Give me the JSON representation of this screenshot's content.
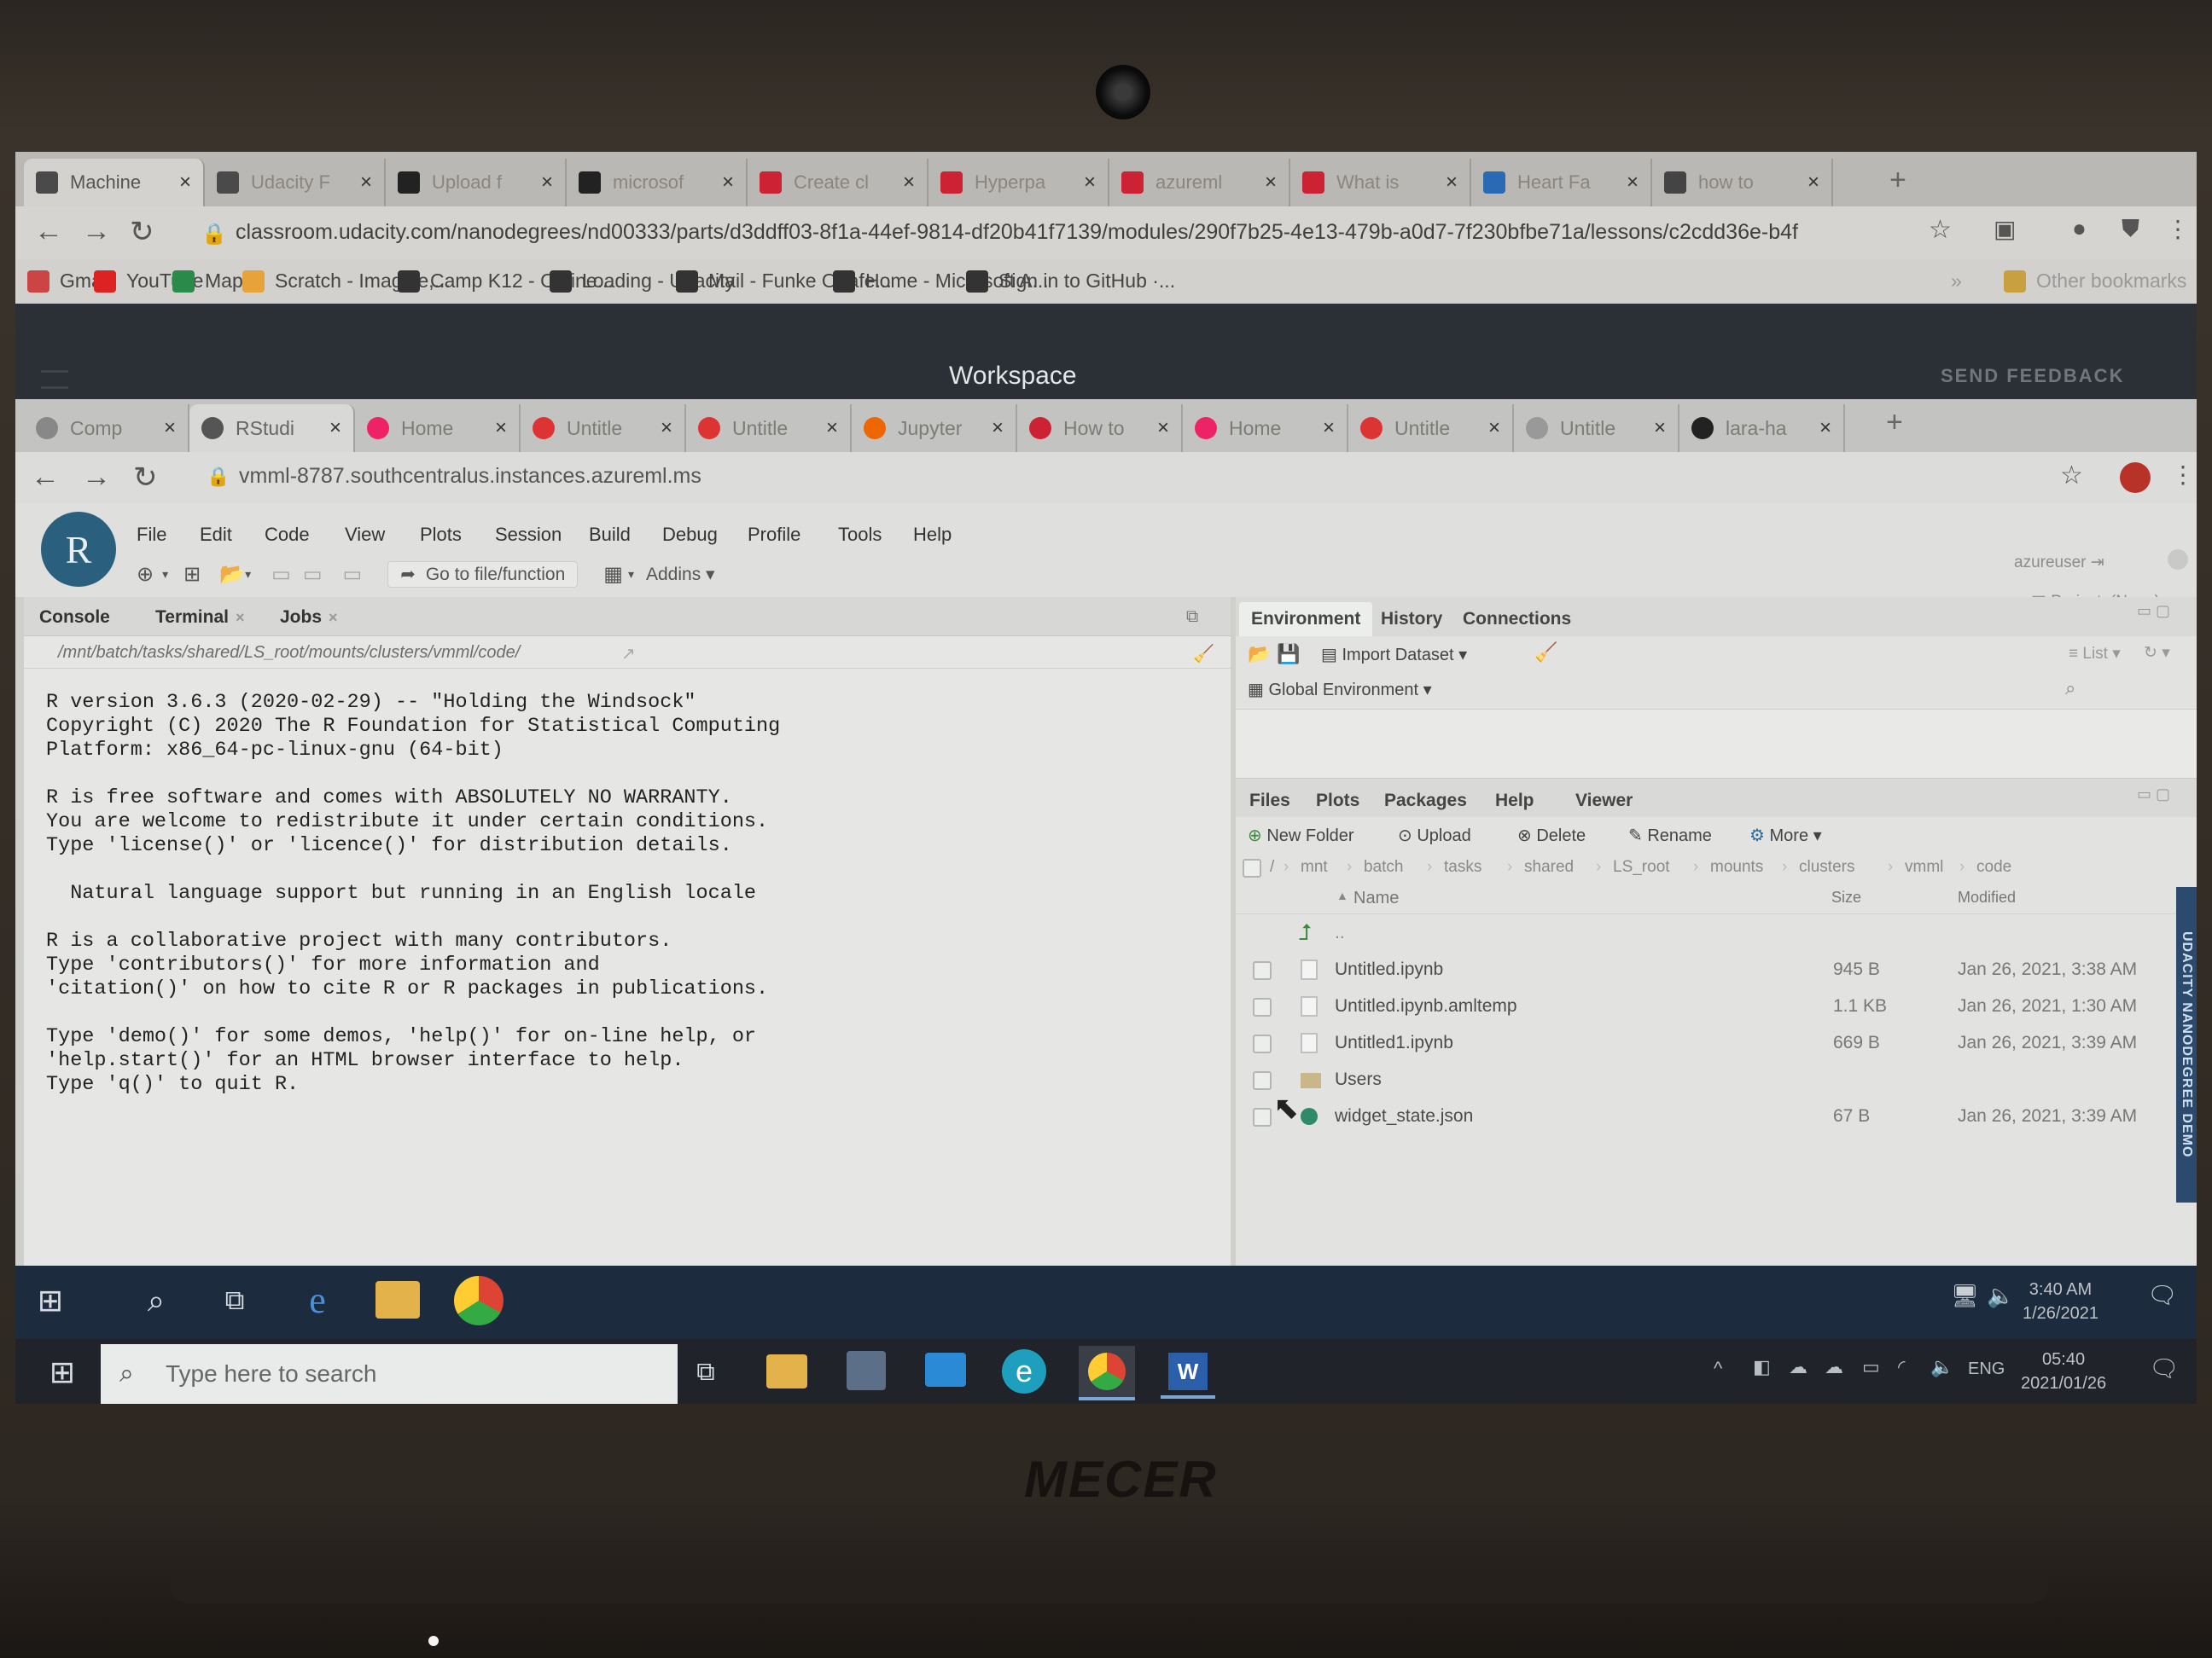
{
  "outer_browser": {
    "tabs": [
      {
        "title": "Machine",
        "favicon": "udacity-icon",
        "color": "#4a4a4a",
        "active": true
      },
      {
        "title": "Udacity F",
        "favicon": "udacity-icon",
        "color": "#4a4a4a"
      },
      {
        "title": "Upload f",
        "favicon": "github-icon",
        "color": "#222"
      },
      {
        "title": "microsof",
        "favicon": "github-icon",
        "color": "#222"
      },
      {
        "title": "Create cl",
        "favicon": "azure-ml-icon",
        "color": "#c23"
      },
      {
        "title": "Hyperpa",
        "favicon": "azure-ml-icon",
        "color": "#c23"
      },
      {
        "title": "azureml",
        "favicon": "azure-ml-icon",
        "color": "#c23"
      },
      {
        "title": "What is",
        "favicon": "azure-ml-icon",
        "color": "#c23"
      },
      {
        "title": "Heart Fa",
        "favicon": "kaggle-icon",
        "color": "#2a6ab5"
      },
      {
        "title": "how to",
        "favicon": "google-icon",
        "color": "#444"
      }
    ],
    "url": "classroom.udacity.com/nanodegrees/nd00333/parts/d3ddff03-8f1a-44ef-9814-df20b41f7139/modules/290f7b25-4e13-479b-a0d7-7f230bfbe71a/lessons/c2cdd36e-b4f",
    "bookmarks": [
      {
        "label": "Gmail",
        "icon": "gmail-icon",
        "color": "#c44"
      },
      {
        "label": "YouTube",
        "icon": "youtube-icon",
        "color": "#d22"
      },
      {
        "label": "Maps",
        "icon": "maps-icon",
        "color": "#2a8a4a"
      },
      {
        "label": "Scratch - Imagine,...",
        "icon": "scratch-icon",
        "color": "#e6a33a"
      },
      {
        "label": "Camp K12 - Online...",
        "icon": "campk12-icon",
        "color": "#333"
      },
      {
        "label": "Loading - Udacity",
        "icon": "udacity-icon",
        "color": "#333"
      },
      {
        "label": "Mail - Funke Onafe...",
        "icon": "outlook-icon",
        "color": "#333"
      },
      {
        "label": "Home - Microsoft A...",
        "icon": "azure-icon",
        "color": "#333"
      },
      {
        "label": "Sign in to GitHub ·...",
        "icon": "github-icon",
        "color": "#333"
      }
    ],
    "other_bookmarks": "Other bookmarks"
  },
  "workspace": {
    "title": "Workspace",
    "feedback": "SEND FEEDBACK"
  },
  "inner_browser": {
    "tabs": [
      {
        "title": "Comp",
        "favicon": "comp-icon",
        "color": "#888"
      },
      {
        "title": "RStudi",
        "favicon": "rstudio-icon",
        "color": "#555",
        "active": true
      },
      {
        "title": "Home",
        "favicon": "jupyter-icon",
        "color": "#e26"
      },
      {
        "title": "Untitle",
        "favicon": "jupyter-icon",
        "color": "#d33"
      },
      {
        "title": "Untitle",
        "favicon": "jupyter-icon",
        "color": "#d33"
      },
      {
        "title": "Jupyter",
        "favicon": "jupyter-icon",
        "color": "#e60"
      },
      {
        "title": "How to",
        "favicon": "azure-ml-icon",
        "color": "#c23"
      },
      {
        "title": "Home",
        "favicon": "jupyter-icon",
        "color": "#e26"
      },
      {
        "title": "Untitle",
        "favicon": "jupyter-icon",
        "color": "#d33"
      },
      {
        "title": "Untitle",
        "favicon": "file-icon",
        "color": "#999"
      },
      {
        "title": "lara-ha",
        "favicon": "github-icon",
        "color": "#222"
      }
    ],
    "url": "vmml-8787.southcentralus.instances.azureml.ms"
  },
  "rstudio": {
    "menu": [
      "File",
      "Edit",
      "Code",
      "View",
      "Plots",
      "Session",
      "Build",
      "Debug",
      "Profile",
      "Tools",
      "Help"
    ],
    "goto_label": "Go to file/function",
    "addins_label": "Addins",
    "user": "azureuser",
    "project": "Project: (None)",
    "left_tabs": [
      "Console",
      "Terminal",
      "Jobs"
    ],
    "console_path": "/mnt/batch/tasks/shared/LS_root/mounts/clusters/vmml/code/",
    "console_text": "R version 3.6.3 (2020-02-29) -- \"Holding the Windsock\"\nCopyright (C) 2020 The R Foundation for Statistical Computing\nPlatform: x86_64-pc-linux-gnu (64-bit)\n\nR is free software and comes with ABSOLUTELY NO WARRANTY.\nYou are welcome to redistribute it under certain conditions.\nType 'license()' or 'licence()' for distribution details.\n\n  Natural language support but running in an English locale\n\nR is a collaborative project with many contributors.\nType 'contributors()' for more information and\n'citation()' on how to cite R or R packages in publications.\n\nType 'demo()' for some demos, 'help()' for on-line help, or\n'help.start()' for an HTML browser interface to help.\nType 'q()' to quit R.\n",
    "prompt": ">",
    "env_tabs": [
      "Environment",
      "History",
      "Connections"
    ],
    "import_dataset": "Import Dataset",
    "list_label": "List",
    "global_env": "Global Environment",
    "files_tabs": [
      "Files",
      "Plots",
      "Packages",
      "Help",
      "Viewer"
    ],
    "files_toolbar": {
      "new_folder": "New Folder",
      "upload": "Upload",
      "delete": "Delete",
      "rename": "Rename",
      "more": "More"
    },
    "breadcrumb": [
      "mnt",
      "batch",
      "tasks",
      "shared",
      "LS_root",
      "mounts",
      "clusters",
      "vmml",
      "code"
    ],
    "columns": {
      "name": "Name",
      "size": "Size",
      "modified": "Modified"
    },
    "parent_dir": "..",
    "files": [
      {
        "name": "Untitled.ipynb",
        "size": "945 B",
        "modified": "Jan 26, 2021, 3:38 AM",
        "icon": "file-icon"
      },
      {
        "name": "Untitled.ipynb.amltemp",
        "size": "1.1 KB",
        "modified": "Jan 26, 2021, 1:30 AM",
        "icon": "file-icon"
      },
      {
        "name": "Untitled1.ipynb",
        "size": "669 B",
        "modified": "Jan 26, 2021, 3:39 AM",
        "icon": "file-icon"
      },
      {
        "name": "Users",
        "size": "",
        "modified": "",
        "icon": "folder-icon"
      },
      {
        "name": "widget_state.json",
        "size": "67 B",
        "modified": "Jan 26, 2021, 3:39 AM",
        "icon": "json-icon"
      }
    ],
    "side_banner": "UDACITY NANODEGREE DEMO"
  },
  "remote_taskbar": {
    "time": "3:40 AM",
    "date": "1/26/2021"
  },
  "local_taskbar": {
    "search_placeholder": "Type here to search",
    "lang": "ENG",
    "time": "05:40",
    "date": "2021/01/26"
  }
}
